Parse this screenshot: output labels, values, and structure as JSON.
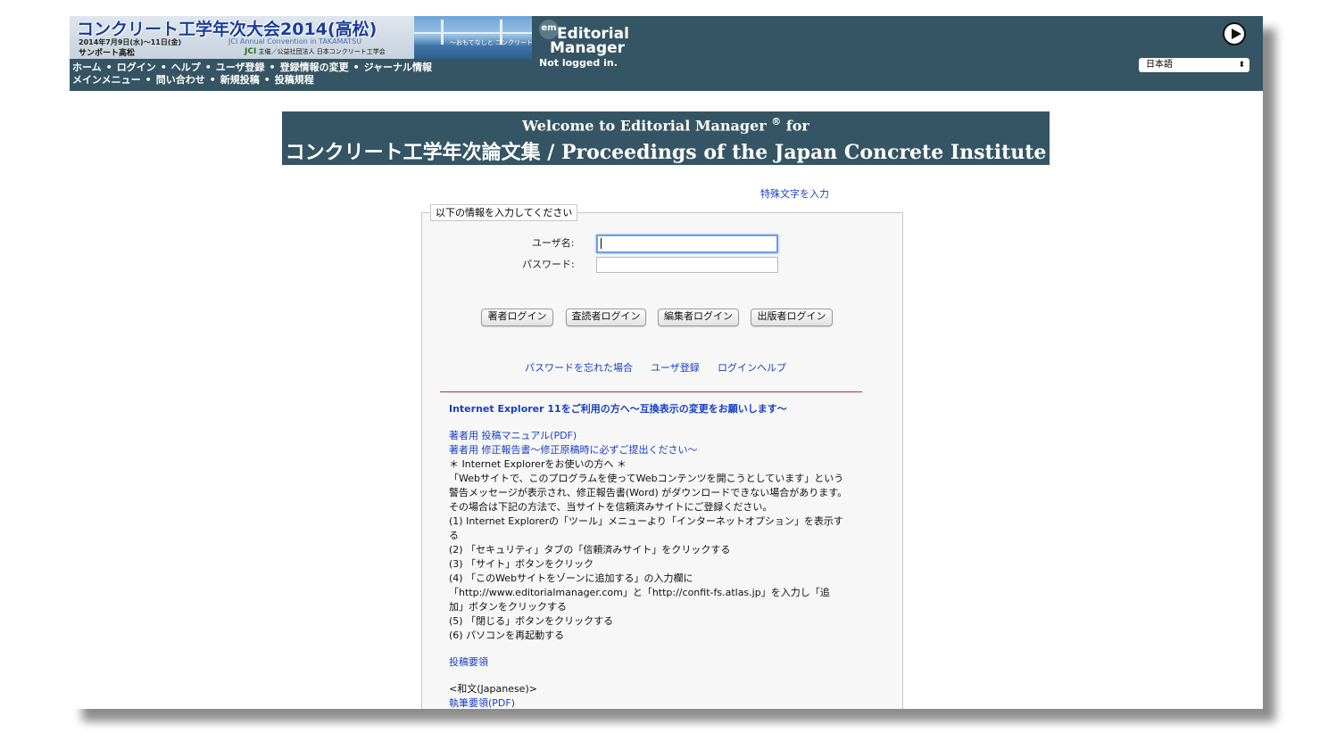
{
  "header": {
    "banner": {
      "title": "コンクリート工学年次大会2014(高松)",
      "date": "2014年7月9日(水)～11日(金)",
      "venue": "サンポート高松",
      "english": "JCI Annual Convention in TAKAMATSU",
      "org_prefix": "JCI",
      "org": "主催／公益社団法人 日本コンクリート工学会",
      "photo_caption": "～おもてなしと コンクリート～"
    },
    "logo": {
      "badge": "em",
      "line1": "Editorial",
      "line2": "Manager"
    },
    "login_status": "Not logged in.",
    "nav_row1": [
      "ホーム",
      "ログイン",
      "ヘルプ",
      "ユーザ登録",
      "登録情報の変更",
      "ジャーナル情報"
    ],
    "nav_row2": [
      "メインメニュー",
      "問い合わせ",
      "新規投稿",
      "投稿規程"
    ],
    "separator": "•",
    "language": "日本語"
  },
  "welcome": {
    "line1": "Welcome to Editorial Manager",
    "reg": "®",
    "line1_suffix": "for",
    "line2": "コンクリート工学年次論文集 / Proceedings of the Japan Concrete Institute"
  },
  "special_chars": "特殊文字を入力",
  "login": {
    "legend": "以下の情報を入力してください",
    "username_label": "ユーザ名:",
    "password_label": "パスワード:",
    "username_value": "",
    "password_value": "",
    "buttons": [
      "著者ログイン",
      "査読者ログイン",
      "編集者ログイン",
      "出版者ログイン"
    ],
    "links": [
      "パスワードを忘れた場合",
      "ユーザ登録",
      "ログインヘルプ"
    ]
  },
  "notice": {
    "ie_heading": "Internet Explorer 11をご利用の方へ～互換表示の変更をお願いします～",
    "manual_link": "著者用 投稿マニュアル(PDF)",
    "report_link": "著者用 修正報告書～修正原稿時に必ずご提出ください～",
    "lines": [
      "＊ Internet Explorerをお使いの方へ ＊",
      "「Webサイトで、このプログラムを使ってWebコンテンツを開こうとしています」という",
      "警告メッセージが表示され、修正報告書(Word) がダウンロードできない場合があります。",
      "その場合は下記の方法で、当サイトを信頼済みサイトにご登録ください。",
      "(1) Internet Explorerの「ツール」メニューより「インターネットオプション」を表示す",
      "る",
      "(2) 「セキュリティ」タブの「信頼済みサイト」をクリックする",
      "(3) 「サイト」ボタンをクリック",
      "(4) 「このWebサイトをゾーンに追加する」の入力欄に",
      "「http://www.editorialmanager.com」と「http://confit-fs.atlas.jp」を入力し「追",
      "加」ボタンをクリックする",
      "(5) 「閉じる」ボタンをクリックする",
      "(6) パソコンを再起動する"
    ],
    "guidelines_link": "投稿要領",
    "japanese_label": "<和文(Japanese)>",
    "writing_link": "執筆要領(PDF)"
  }
}
